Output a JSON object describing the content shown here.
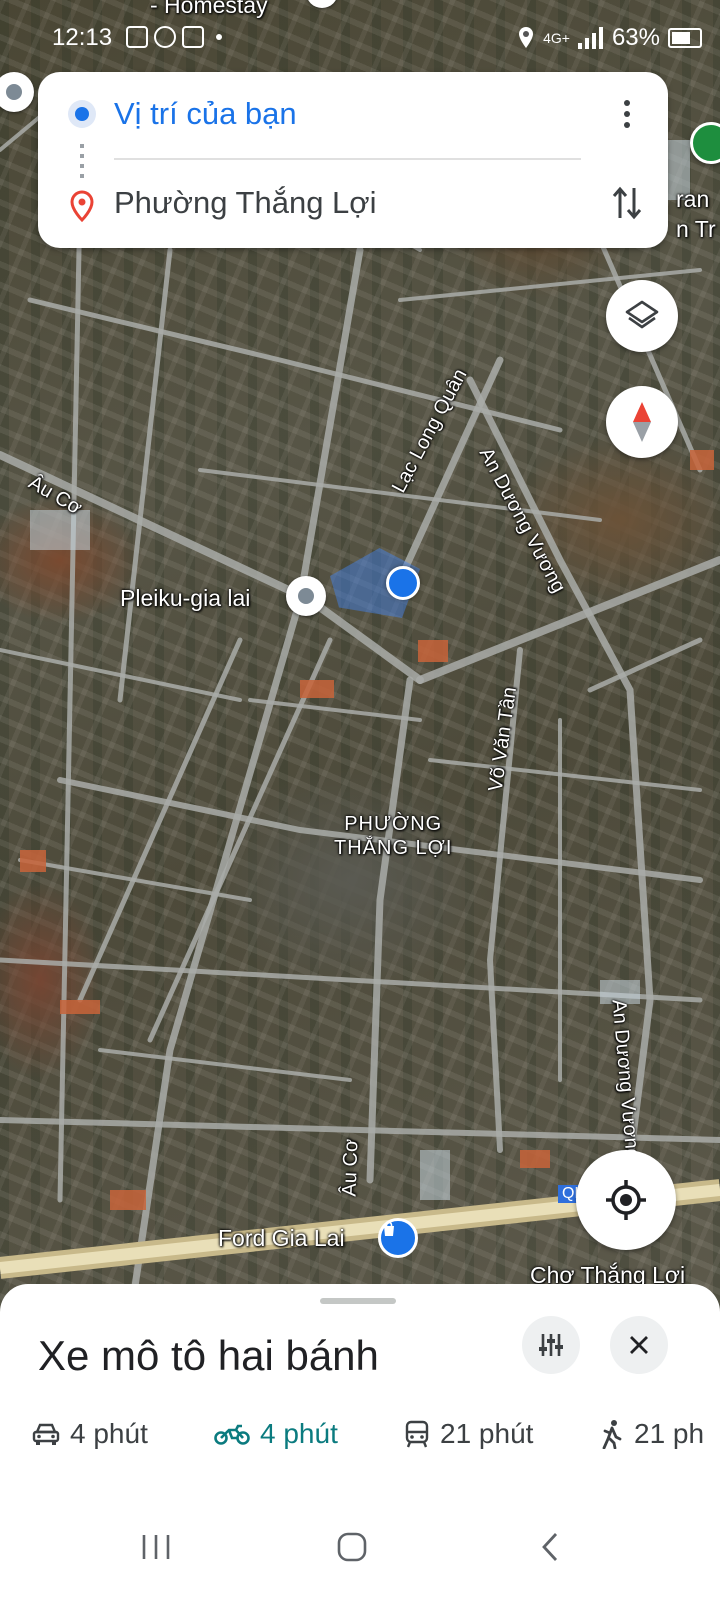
{
  "status_bar": {
    "time": "12:13",
    "network": "4G+",
    "battery": "63%"
  },
  "directions": {
    "origin": "Vị trí của bạn",
    "destination": "Phường Thắng Lợi"
  },
  "map": {
    "poi_top_fragment": "- Homestay",
    "poi_right_fragment": "ran",
    "poi_right_fragment2": "n Tr",
    "poi_pleiku": "Pleiku-gia lai",
    "district_line1": "PHƯỜNG",
    "district_line2": "THẮNG LỢI",
    "poi_ford": "Ford Gia Lai",
    "poi_cho": "Chợ Thắng Lợi",
    "highway_shield": "QL",
    "streets": {
      "au_co_1": "Âu Cơ",
      "lac_long_quan": "Lạc Long Quân",
      "an_duong_vuong_1": "An Dương Vương",
      "vo_van_tan": "Võ Văn Tần",
      "an_duong_vuong_2": "An Dương Vương",
      "au_co_2": "Âu Cơ"
    }
  },
  "sheet": {
    "title": "Xe mô tô hai bánh",
    "modes": [
      {
        "icon": "car-icon",
        "label": "4 phút",
        "active": false
      },
      {
        "icon": "motorbike-icon",
        "label": "4 phút",
        "active": true
      },
      {
        "icon": "transit-icon",
        "label": "21 phút",
        "active": false
      },
      {
        "icon": "walk-icon",
        "label": "21 ph",
        "active": false
      }
    ]
  },
  "colors": {
    "accent_blue": "#1a73e8",
    "active_mode": "#0b7b7f",
    "destination_pin": "#ea4335"
  }
}
